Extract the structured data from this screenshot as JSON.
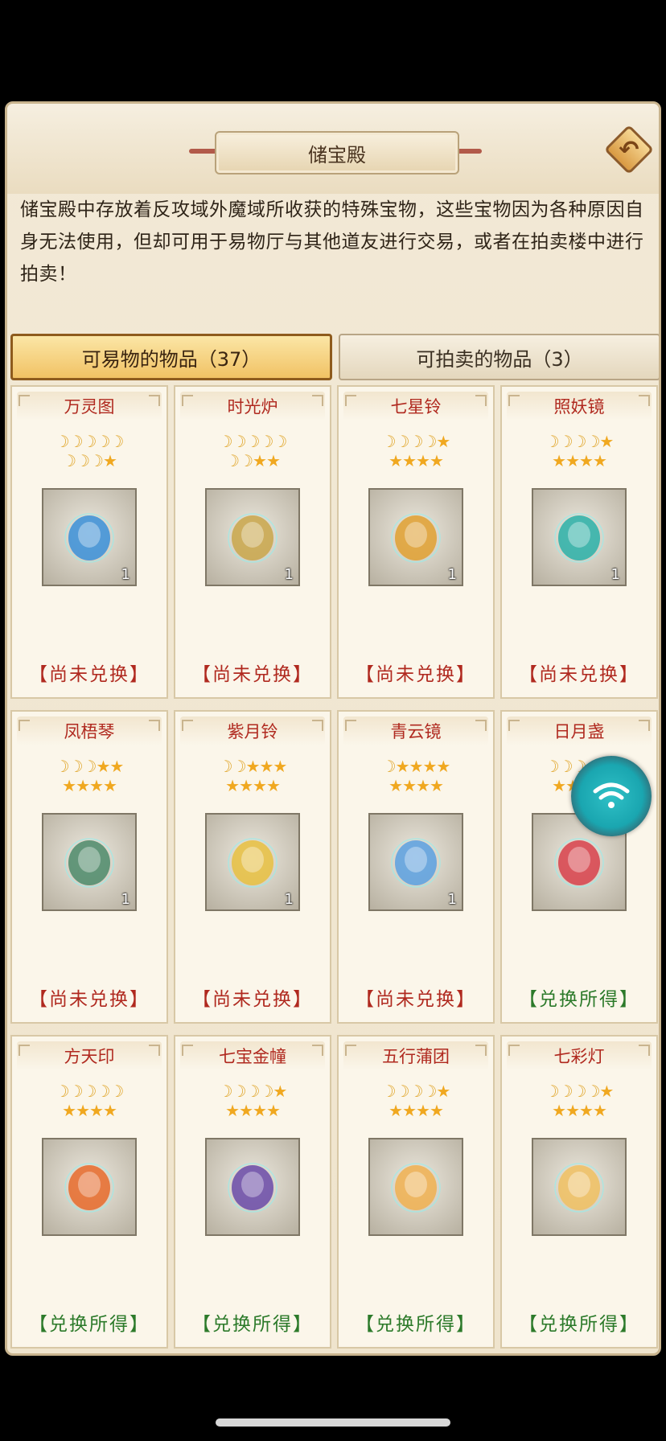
{
  "header": {
    "title": "储宝殿",
    "back_icon": "back-arrow-icon"
  },
  "description": "储宝殿中存放着反攻域外魔域所收获的特殊宝物，这些宝物因为各种原因自身无法使用，但却可用于易物厅与其他道友进行交易，或者在拍卖楼中进行拍卖！",
  "tabs": [
    {
      "label": "可易物的物品（37）",
      "active": true
    },
    {
      "label": "可拍卖的物品（3）",
      "active": false
    }
  ],
  "items": [
    {
      "name": "万灵图",
      "moons": 8,
      "stars": 1,
      "count": "1",
      "status": "【尚未兑换】",
      "done": false,
      "color": "#3a8fd8"
    },
    {
      "name": "时光炉",
      "moons": 7,
      "stars": 2,
      "count": "1",
      "status": "【尚未兑换】",
      "done": false,
      "color": "#c9a64a"
    },
    {
      "name": "七星铃",
      "moons": 4,
      "stars": 5,
      "count": "1",
      "status": "【尚未兑换】",
      "done": false,
      "color": "#e0a030"
    },
    {
      "name": "照妖镜",
      "moons": 4,
      "stars": 5,
      "count": "1",
      "status": "【尚未兑换】",
      "done": false,
      "color": "#2ab0a8"
    },
    {
      "name": "凤梧琴",
      "moons": 3,
      "stars": 6,
      "count": "1",
      "status": "【尚未兑换】",
      "done": false,
      "color": "#4c8a6a"
    },
    {
      "name": "紫月铃",
      "moons": 2,
      "stars": 7,
      "count": "1",
      "status": "【尚未兑换】",
      "done": false,
      "color": "#e8c040"
    },
    {
      "name": "青云镜",
      "moons": 1,
      "stars": 8,
      "count": "1",
      "status": "【尚未兑换】",
      "done": false,
      "color": "#5aa0e0"
    },
    {
      "name": "日月盏",
      "moons": 3,
      "stars": 6,
      "count": "",
      "status": "【兑换所得】",
      "done": true,
      "color": "#d8404a"
    },
    {
      "name": "方天印",
      "moons": 5,
      "stars": 4,
      "count": "",
      "status": "【兑换所得】",
      "done": true,
      "color": "#e86a2a"
    },
    {
      "name": "七宝金幢",
      "moons": 4,
      "stars": 5,
      "count": "",
      "status": "【兑换所得】",
      "done": true,
      "color": "#6a4aa8"
    },
    {
      "name": "五行蒲团",
      "moons": 4,
      "stars": 5,
      "count": "",
      "status": "【兑换所得】",
      "done": true,
      "color": "#f0b050"
    },
    {
      "name": "七彩灯",
      "moons": 4,
      "stars": 5,
      "count": "",
      "status": "【兑换所得】",
      "done": true,
      "color": "#f0c060"
    }
  ],
  "floating_button": {
    "icon": "wifi-icon"
  },
  "colors": {
    "item_name": "#b0291f",
    "pending_status": "#b0291f",
    "done_status": "#2c7a2a",
    "moon": "#e1a830",
    "star": "#f0a820"
  }
}
